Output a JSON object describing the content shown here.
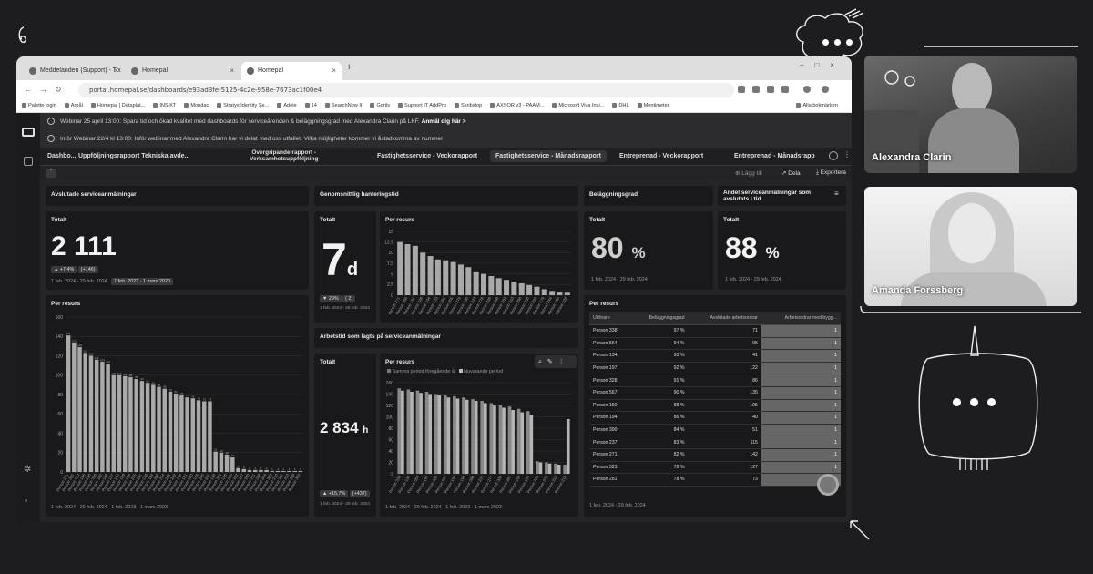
{
  "browser": {
    "tabs": [
      {
        "label": "Meddelanden (Support) - Tix"
      },
      {
        "label": "Homepal"
      },
      {
        "label": "Homepal"
      }
    ],
    "url": "portal.homepal.se/dashboards/e93ad3fe-5125-4c2e-958e-7673ac1f00e4",
    "bookmarks": [
      "Palette login",
      "Arpål",
      "Homepal | Dataplat...",
      "INSIKT",
      "Mondac",
      "Stratys Identity Se...",
      "Adele",
      "14",
      "SearchNow II",
      "Gorils",
      "Support IT AddPro",
      "Skribstop",
      "AXSOR v3 - PAAM...",
      "Microsoft Viva Insi...",
      "DHL",
      "Mentimeter"
    ],
    "bookmarks_other": "Alla bokmärken"
  },
  "banner": {
    "line1_text": "Webinar 25 april 13:00: Spara tid och ökad kvalitet med dashboards för serviceärenden & beläggningsgrad med Alexandra Clarin på LKF.",
    "line1_link": "Anmäl dig här >",
    "line2_text": "Inför Webinar 22/4 kl 13:00: Inför webinar med Alexandra Clarin har vi delat med oss utfallet. Vilka möjligheter kommer vi åstadkomma av nummer"
  },
  "report_tabs": [
    {
      "label": "Dashbo..."
    },
    {
      "label": "Uppföljningsrapport Tekniska avde..."
    },
    {
      "label": "Övergripande rapport -\nVerksamhetsuppföljning"
    },
    {
      "label": "Fastighetsservice - Veckorapport"
    },
    {
      "label": "Fastighetsservice - Månadsrapport"
    },
    {
      "label": "Entreprenad - Veckorapport"
    },
    {
      "label": "Entreprenad - Månadsrapp"
    }
  ],
  "toolbar": {
    "save": "Lägg till",
    "share": "Dela",
    "export": "Exportera"
  },
  "cards": {
    "avslutade": {
      "header": "Avslutade serviceanmälningar",
      "total_title": "Totalt",
      "total_value": "2 111",
      "delta_pct": "▲ +7,4%",
      "delta_abs": "(+146)",
      "dates": "1 feb. 2024 - 29 feb. 2024",
      "dates_cmp": "1 feb. 2023 - 1 mars 2023",
      "per_resurs_title": "Per resurs",
      "per_resurs_dates": "1 feb. 2024 - 29 feb. 2024",
      "per_resurs_dates_cmp": "1 feb. 2023 - 1 mars 2023"
    },
    "genomsnitt": {
      "header": "Genomsnittlig hanteringstid",
      "total_title": "Totalt",
      "total_value": "7",
      "total_unit": "d",
      "delta_pct": "▼ 29%",
      "delta_abs": "( 2)",
      "dates": "1 feb. 2024 - 29 feb. 2024",
      "per_resurs_title": "Per resurs"
    },
    "arbetstid": {
      "header": "Arbetstid som lagts på serviceanmälningar",
      "total_title": "Totalt",
      "total_value": "2 834",
      "total_unit": "h",
      "delta_pct": "▲ +15,7%",
      "delta_abs": "(+437)",
      "dates": "1 feb. 2024 - 29 feb. 2024",
      "per_resurs_title": "Per resurs",
      "legend_prev": "Samma period föregående år",
      "legend_curr": "Nuvarande period",
      "per_resurs_dates": "1 feb. 2024 - 29 feb. 2024",
      "per_resurs_dates_cmp": "1 feb. 2023 - 1 mars 2023"
    },
    "belaggning": {
      "header": "Beläggningsgrad",
      "total_title": "Totalt",
      "total_value": "80",
      "total_unit": "%",
      "dates": "1 feb. 2024 - 29 feb. 2024"
    },
    "avslutade_i_tid": {
      "header": "Andel serviceanmälningar som avslutats i tid",
      "total_title": "Totalt",
      "total_value": "88",
      "total_unit": "%",
      "dates": "1 feb. 2024 - 29 feb. 2024"
    },
    "table": {
      "title": "Per resurs",
      "columns": [
        "Utförare",
        "Beläggningsgrad",
        "Avslutade arbetsordrar",
        "Arbetsordrar med bygg..."
      ],
      "rows": [
        [
          "Person 338",
          "97 %",
          "71",
          "1"
        ],
        [
          "Person 564",
          "94 %",
          "95",
          "1"
        ],
        [
          "Person 134",
          "93 %",
          "41",
          "1"
        ],
        [
          "Person 197",
          "92 %",
          "122",
          "1"
        ],
        [
          "Person 328",
          "91 %",
          "86",
          "1"
        ],
        [
          "Person 567",
          "90 %",
          "135",
          "1"
        ],
        [
          "Person 150",
          "88 %",
          "105",
          "1"
        ],
        [
          "Person 194",
          "86 %",
          "40",
          "1"
        ],
        [
          "Person 390",
          "84 %",
          "51",
          "1"
        ],
        [
          "Person 237",
          "83 %",
          "115",
          "1"
        ],
        [
          "Person 271",
          "82 %",
          "142",
          "1"
        ],
        [
          "Person 323",
          "78 %",
          "127",
          "1"
        ],
        [
          "Person 281",
          "78 %",
          "73",
          "1"
        ]
      ],
      "dates": "1 feb. 2024 - 29 feb. 2024"
    }
  },
  "participants": [
    {
      "name": "Alexandra Clarin"
    },
    {
      "name": "Amanda Forssberg"
    }
  ],
  "chart_data": [
    {
      "type": "bar",
      "title": "Per resurs",
      "ylim": [
        0,
        160
      ],
      "yticks": [
        0,
        20,
        40,
        60,
        80,
        100,
        120,
        140,
        160
      ],
      "categories": [
        "Person 271",
        "Person 331",
        "Person 123",
        "Person 156",
        "Person 150",
        "Person 390",
        "Person 182",
        "Person 148",
        "Person 197",
        "Person 166",
        "Person 139",
        "Person 128",
        "Person 225",
        "Person 281",
        "Person 158",
        "Person 134",
        "Person 230",
        "Person 254",
        "Person 245",
        "Person 262",
        "Person 178",
        "Person 121",
        "Person 320",
        "Person 144",
        "Person 245",
        "Person 201",
        "Person 160",
        "Person 311",
        "Person 166",
        "Person 226",
        "Person 322",
        "Person 127",
        "Person 340",
        "Person 211",
        "Person 298",
        "Person 344",
        "Person 302",
        "Person 210",
        "Person 367",
        "Person 310",
        "Person 209",
        "Person 303"
      ],
      "values": [
        141,
        133,
        129,
        123,
        120,
        116,
        114,
        112,
        100,
        100,
        99,
        98,
        96,
        94,
        92,
        90,
        88,
        86,
        83,
        81,
        79,
        77,
        76,
        74,
        73,
        73,
        21,
        20,
        18,
        15,
        4,
        3,
        2,
        2,
        2,
        2,
        1,
        1,
        1,
        1,
        1,
        1
      ],
      "grid": true
    },
    {
      "type": "bar",
      "title": "Per resurs",
      "ylim": [
        0,
        15
      ],
      "yticks": [
        0,
        2.5,
        5,
        7.5,
        10,
        12.5,
        15
      ],
      "categories": [
        "Person 271",
        "Person 260",
        "Person 197",
        "Person 328",
        "Person 134",
        "Person 133",
        "Person 281",
        "Person 255",
        "Person 279",
        "Person 130",
        "Person 243",
        "Person 278",
        "Person 228",
        "Person 168",
        "Person 203",
        "Person 310",
        "Person 298",
        "Person 250",
        "Person 262",
        "Person 179",
        "Person 244",
        "Person 165",
        "Person 328"
      ],
      "values": [
        12.5,
        12,
        11.6,
        10,
        9.2,
        8.4,
        8.2,
        7.8,
        7.2,
        6.6,
        5.6,
        5,
        4.5,
        4,
        3.6,
        3.2,
        2.8,
        2.4,
        2,
        1.4,
        1,
        0.8,
        0.6
      ],
      "grid": true
    },
    {
      "type": "bar",
      "title": "Per resurs",
      "ylim": [
        0,
        160
      ],
      "yticks": [
        0,
        20,
        40,
        60,
        80,
        100,
        120,
        140,
        160
      ],
      "categories": [
        "Person 338",
        "Person 134",
        "Person 564",
        "Person 197",
        "Person 328",
        "Person 567",
        "Person 150",
        "Person 194",
        "Person 390",
        "Person 237",
        "Person 271",
        "Person 323",
        "Person 281",
        "Person 156",
        "Person 124",
        "Person 226",
        "Person 233",
        "Person 312",
        "Person 216"
      ],
      "series": [
        {
          "name": "Samma period föregående år",
          "values": [
            150,
            148,
            146,
            144,
            140,
            138,
            136,
            134,
            131,
            128,
            124,
            121,
            118,
            114,
            110,
            22,
            20,
            18,
            16
          ]
        },
        {
          "name": "Nuvarande period",
          "values": [
            146,
            144,
            142,
            140,
            138,
            134,
            132,
            130,
            128,
            124,
            120,
            116,
            112,
            108,
            104,
            20,
            18,
            16,
            96
          ]
        }
      ],
      "grid": true
    }
  ]
}
